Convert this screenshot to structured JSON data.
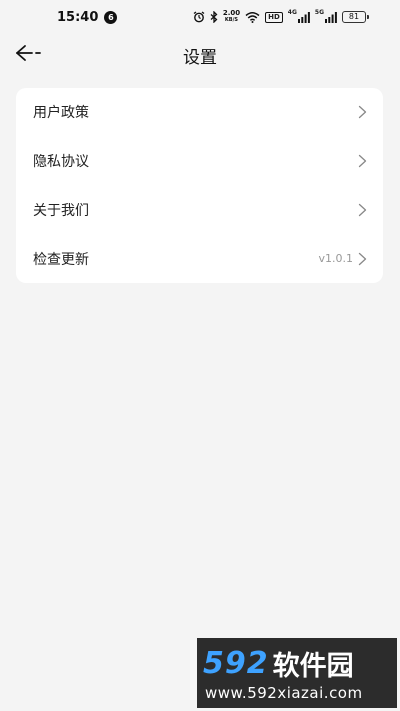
{
  "status_bar": {
    "time": "15:40",
    "notification_count": "6",
    "net_speed_value": "2.00",
    "net_speed_unit": "KB/S",
    "hd_label": "HD",
    "sim1_label": "4G",
    "sim2_label": "5G",
    "battery_level": "81"
  },
  "header": {
    "title": "设置"
  },
  "settings": {
    "items": [
      {
        "label": "用户政策",
        "value": ""
      },
      {
        "label": "隐私协议",
        "value": ""
      },
      {
        "label": "关于我们",
        "value": ""
      },
      {
        "label": "检查更新",
        "value": "v1.0.1"
      }
    ]
  },
  "watermark": {
    "number": "592",
    "brand": "软件园",
    "url": "www.592xiazai.com"
  },
  "colors": {
    "background": "#f4f4f4",
    "card": "#ffffff",
    "watermark_bg": "#2c2c2c",
    "watermark_accent": "#3ea2ff"
  }
}
